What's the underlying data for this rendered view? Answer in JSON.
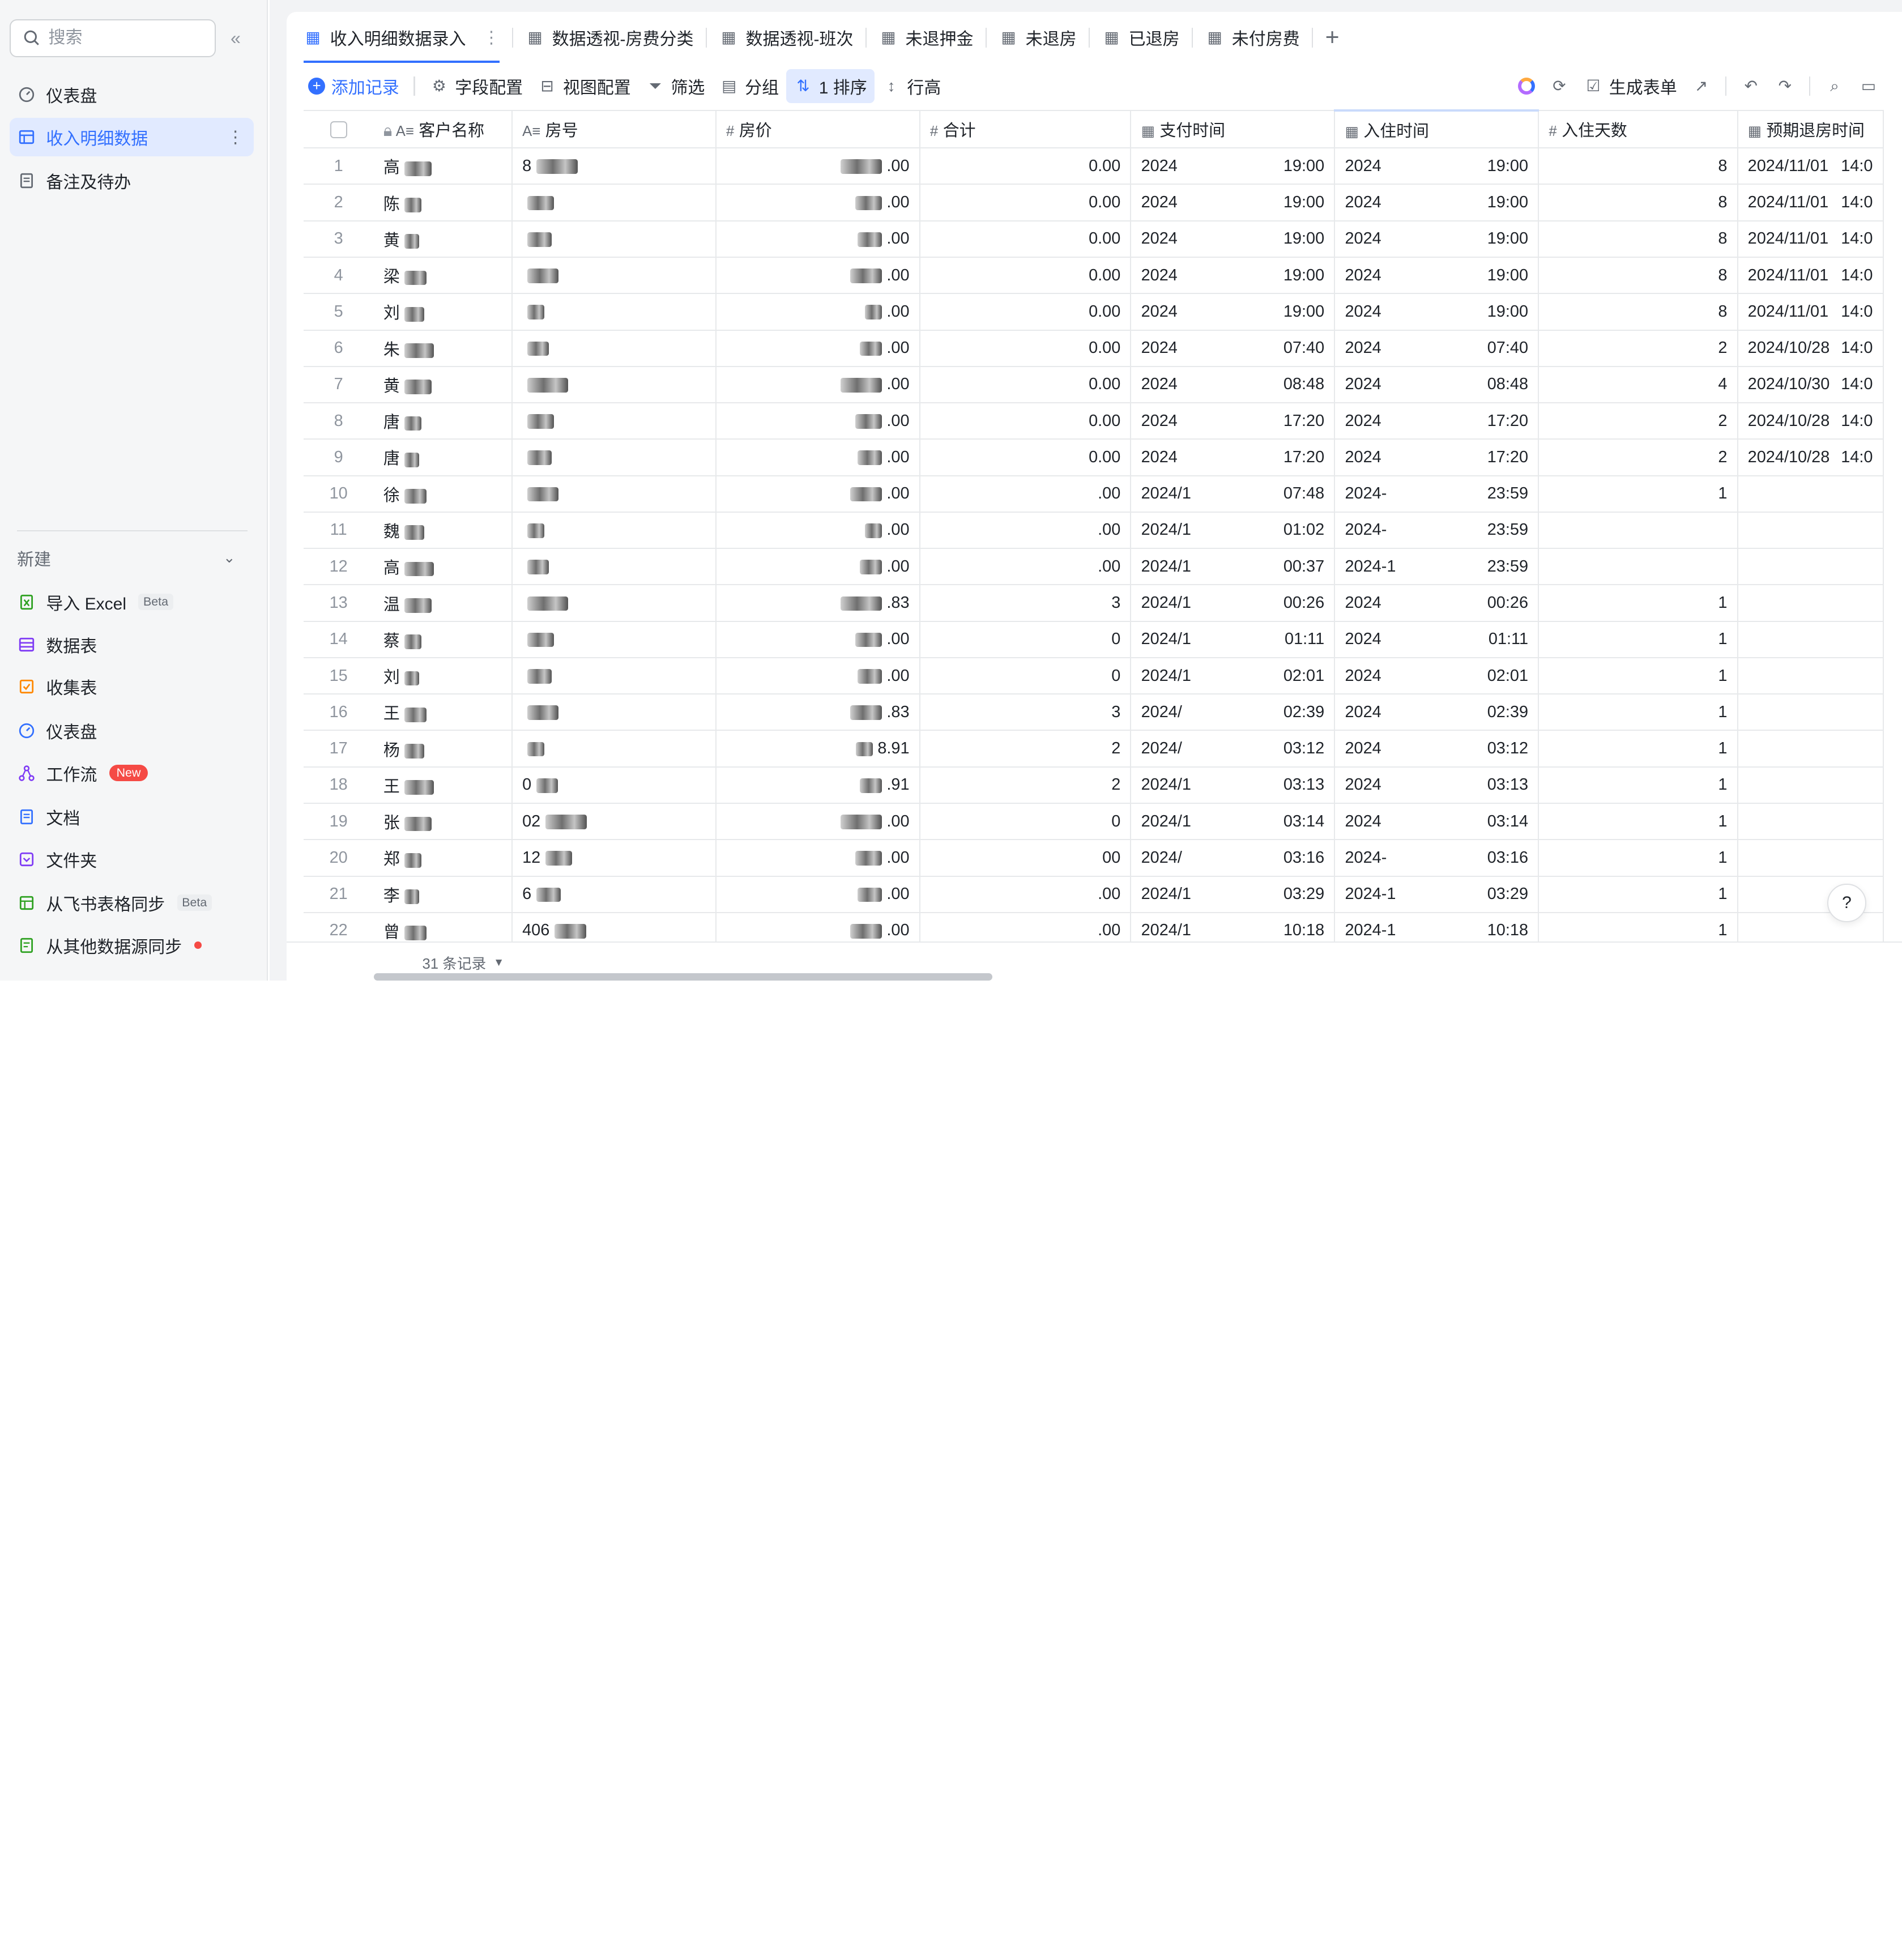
{
  "sidebar": {
    "search_placeholder": "搜索",
    "items": [
      {
        "label": "仪表盘",
        "icon": "dashboard-icon"
      },
      {
        "label": "收入明细数据",
        "icon": "table-icon",
        "active": true
      },
      {
        "label": "备注及待办",
        "icon": "doc-icon"
      }
    ],
    "new_label": "新建",
    "create_items": [
      {
        "label": "导入 Excel",
        "badge": "Beta",
        "icon": "excel-icon",
        "color": "#2ea121"
      },
      {
        "label": "数据表",
        "badge": "",
        "icon": "table-icon",
        "color": "#7f3bf5"
      },
      {
        "label": "收集表",
        "badge": "",
        "icon": "form-icon",
        "color": "#ff8800"
      },
      {
        "label": "仪表盘",
        "badge": "",
        "icon": "dashboard-icon",
        "color": "#3370ff"
      },
      {
        "label": "工作流",
        "badge": "New",
        "icon": "workflow-icon",
        "color": "#7f3bf5"
      },
      {
        "label": "文档",
        "badge": "",
        "icon": "doc-icon",
        "color": "#3370ff"
      },
      {
        "label": "文件夹",
        "badge": "",
        "icon": "folder-icon",
        "color": "#7f3bf5"
      },
      {
        "label": "从飞书表格同步",
        "badge": "Beta",
        "icon": "sheet-sync-icon",
        "color": "#2ea121"
      },
      {
        "label": "从其他数据源同步",
        "badge": "",
        "icon": "datasource-sync-icon",
        "color": "#2ea121"
      }
    ]
  },
  "tabs": [
    {
      "label": "收入明细数据录入",
      "active": true
    },
    {
      "label": "数据透视-房费分类"
    },
    {
      "label": "数据透视-班次"
    },
    {
      "label": "未退押金"
    },
    {
      "label": "未退房"
    },
    {
      "label": "已退房"
    },
    {
      "label": "未付房费"
    }
  ],
  "toolbar": {
    "add_record": "添加记录",
    "field_config": "字段配置",
    "view_config": "视图配置",
    "filter": "筛选",
    "group": "分组",
    "sort": "1 排序",
    "row_height": "行高",
    "generate_form": "生成表单"
  },
  "columns": [
    "客户名称",
    "房号",
    "房价",
    "合计",
    "支付时间",
    "入住时间",
    "入住天数",
    "预期退房时间"
  ],
  "rows": [
    {
      "n": "1",
      "name": "高",
      "room": "8",
      "price": ".00",
      "total": "0.00",
      "pay_d": "2024",
      "pay_t": "19:00",
      "in_d": "2024",
      "in_t": "19:00",
      "days": "8",
      "out_d": "2024/11/01",
      "out_t": "14:0"
    },
    {
      "n": "2",
      "name": "陈",
      "room": "",
      "price": ".00",
      "total": "0.00",
      "pay_d": "2024",
      "pay_t": "19:00",
      "in_d": "2024",
      "in_t": "19:00",
      "days": "8",
      "out_d": "2024/11/01",
      "out_t": "14:0"
    },
    {
      "n": "3",
      "name": "黄",
      "room": "",
      "price": ".00",
      "total": "0.00",
      "pay_d": "2024",
      "pay_t": "19:00",
      "in_d": "2024",
      "in_t": "19:00",
      "days": "8",
      "out_d": "2024/11/01",
      "out_t": "14:0"
    },
    {
      "n": "4",
      "name": "梁",
      "room": "",
      "price": ".00",
      "total": "0.00",
      "pay_d": "2024",
      "pay_t": "19:00",
      "in_d": "2024",
      "in_t": "19:00",
      "days": "8",
      "out_d": "2024/11/01",
      "out_t": "14:0"
    },
    {
      "n": "5",
      "name": "刘",
      "room": "",
      "price": ".00",
      "total": "0.00",
      "pay_d": "2024",
      "pay_t": "19:00",
      "in_d": "2024",
      "in_t": "19:00",
      "days": "8",
      "out_d": "2024/11/01",
      "out_t": "14:0"
    },
    {
      "n": "6",
      "name": "朱",
      "room": "",
      "price": ".00",
      "total": "0.00",
      "pay_d": "2024",
      "pay_t": "07:40",
      "in_d": "2024",
      "in_t": "07:40",
      "days": "2",
      "out_d": "2024/10/28",
      "out_t": "14:0"
    },
    {
      "n": "7",
      "name": "黄",
      "room": "",
      "price": ".00",
      "total": "0.00",
      "pay_d": "2024",
      "pay_t": "08:48",
      "in_d": "2024",
      "in_t": "08:48",
      "days": "4",
      "out_d": "2024/10/30",
      "out_t": "14:0"
    },
    {
      "n": "8",
      "name": "唐",
      "room": "",
      "price": ".00",
      "total": "0.00",
      "pay_d": "2024",
      "pay_t": "17:20",
      "in_d": "2024",
      "in_t": "17:20",
      "days": "2",
      "out_d": "2024/10/28",
      "out_t": "14:0"
    },
    {
      "n": "9",
      "name": "唐",
      "room": "",
      "price": ".00",
      "total": "0.00",
      "pay_d": "2024",
      "pay_t": "17:20",
      "in_d": "2024",
      "in_t": "17:20",
      "days": "2",
      "out_d": "2024/10/28",
      "out_t": "14:0"
    },
    {
      "n": "10",
      "name": "徐",
      "room": "",
      "price": ".00",
      "total": ".00",
      "pay_d": "2024/1",
      "pay_t": "07:48",
      "in_d": "2024-",
      "in_t": "23:59",
      "days": "1",
      "out_d": "",
      "out_t": ""
    },
    {
      "n": "11",
      "name": "魏",
      "room": "",
      "price": ".00",
      "total": ".00",
      "pay_d": "2024/1",
      "pay_t": "01:02",
      "in_d": "2024-",
      "in_t": "23:59",
      "days": "",
      "out_d": "",
      "out_t": ""
    },
    {
      "n": "12",
      "name": "高",
      "room": "",
      "price": ".00",
      "total": ".00",
      "pay_d": "2024/1",
      "pay_t": "00:37",
      "in_d": "2024-1",
      "in_t": "23:59",
      "days": "",
      "out_d": "",
      "out_t": ""
    },
    {
      "n": "13",
      "name": "温",
      "room": "",
      "price": ".83",
      "total": "3",
      "pay_d": "2024/1",
      "pay_t": "00:26",
      "in_d": "2024",
      "in_t": "00:26",
      "days": "1",
      "out_d": "",
      "out_t": ""
    },
    {
      "n": "14",
      "name": "蔡",
      "room": "",
      "price": ".00",
      "total": "0",
      "pay_d": "2024/1",
      "pay_t": "01:11",
      "in_d": "2024",
      "in_t": "01:11",
      "days": "1",
      "out_d": "",
      "out_t": ""
    },
    {
      "n": "15",
      "name": "刘",
      "room": "",
      "price": ".00",
      "total": "0",
      "pay_d": "2024/1",
      "pay_t": "02:01",
      "in_d": "2024",
      "in_t": "02:01",
      "days": "1",
      "out_d": "",
      "out_t": ""
    },
    {
      "n": "16",
      "name": "王",
      "room": "",
      "price": ".83",
      "total": "3",
      "pay_d": "2024/",
      "pay_t": "02:39",
      "in_d": "2024",
      "in_t": "02:39",
      "days": "1",
      "out_d": "",
      "out_t": ""
    },
    {
      "n": "17",
      "name": "杨",
      "room": "",
      "price": "8.91",
      "total": "2",
      "pay_d": "2024/",
      "pay_t": "03:12",
      "in_d": "2024",
      "in_t": "03:12",
      "days": "1",
      "out_d": "",
      "out_t": ""
    },
    {
      "n": "18",
      "name": "王",
      "room": "0",
      "price": ".91",
      "total": "2",
      "pay_d": "2024/1",
      "pay_t": "03:13",
      "in_d": "2024",
      "in_t": "03:13",
      "days": "1",
      "out_d": "",
      "out_t": ""
    },
    {
      "n": "19",
      "name": "张",
      "room": "02",
      "price": ".00",
      "total": "0",
      "pay_d": "2024/1",
      "pay_t": "03:14",
      "in_d": "2024",
      "in_t": "03:14",
      "days": "1",
      "out_d": "",
      "out_t": ""
    },
    {
      "n": "20",
      "name": "郑",
      "room": "12",
      "price": ".00",
      "total": "00",
      "pay_d": "2024/",
      "pay_t": "03:16",
      "in_d": "2024-",
      "in_t": "03:16",
      "days": "1",
      "out_d": "",
      "out_t": ""
    },
    {
      "n": "21",
      "name": "李",
      "room": "6",
      "price": ".00",
      "total": ".00",
      "pay_d": "2024/1",
      "pay_t": "03:29",
      "in_d": "2024-1",
      "in_t": "03:29",
      "days": "1",
      "out_d": "",
      "out_t": ""
    },
    {
      "n": "22",
      "name": "曾",
      "room": "406",
      "price": ".00",
      "total": ".00",
      "pay_d": "2024/1",
      "pay_t": "10:18",
      "in_d": "2024-1",
      "in_t": "10:18",
      "days": "1",
      "out_d": "",
      "out_t": ""
    }
  ],
  "footer": {
    "record_count": "31 条记录"
  },
  "colors": {
    "accent": "#3370ff",
    "active_bg": "#e1eaff",
    "sidebar_bg": "#f5f6f7"
  }
}
